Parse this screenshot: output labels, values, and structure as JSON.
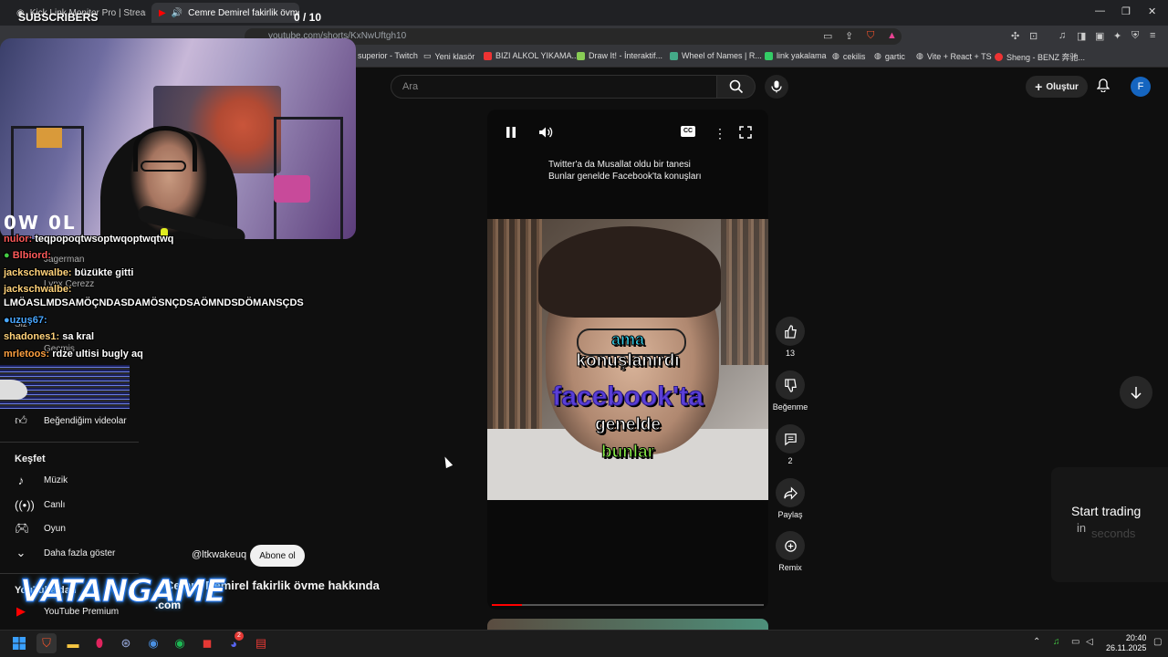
{
  "browser": {
    "tabs": [
      {
        "label": "Kick Link Monitor Pro | Stream Deck",
        "active": false
      },
      {
        "label": "Cemre Demirel fakirlik övme",
        "active": true
      }
    ],
    "new_tab": "+",
    "address": "youtube.com/shorts/KxNwUftgh10",
    "window_controls": {
      "minimize": "—",
      "restore": "❐",
      "close": "✕"
    },
    "bookmarks": [
      "superior - Twitch",
      "Yeni klasör",
      "BIZI ALKOL YIKAMA...",
      "Draw It! - İnteraktif...",
      "Wheel of Names | R...",
      "link yakalama",
      "cekilis",
      "gartic",
      "Vite + React + TS",
      "Sheng - BENZ 奔驰..."
    ]
  },
  "youtube": {
    "search_placeholder": "Ara",
    "create_label": "Oluştur",
    "avatar_letter": "F",
    "sidebar": {
      "hidden_items": [
        "Jagerman",
        "Lynx Cerezz",
        "Siz",
        "Geçmiş"
      ],
      "liked_videos": "Beğendiğim videolar",
      "explore_heading": "Keşfet",
      "explore_items": [
        "Müzik",
        "Canlı",
        "Oyun"
      ],
      "show_more": "Daha fazla göster",
      "more_heading": "YouTube'dan",
      "premium": "YouTube Premium"
    },
    "short": {
      "top_caption_line1": "Twitter'a da Musallat oldu bir tanesi",
      "top_caption_line2": "Bunlar genelde Facebook'ta konuşları",
      "subtitles": [
        "ama",
        "konuşlanırdı",
        "facebook'ta",
        "genelde",
        "bunlar"
      ],
      "progress": 0.11,
      "channel": "@ltkwakeuq",
      "subscribe": "Abone ol",
      "title": "Cemre Demirel fakirlik övme hakkında"
    },
    "actions": {
      "like_count": "13",
      "dislike_label": "Beğenme",
      "comment_count": "2",
      "share_label": "Paylaş",
      "remix_label": "Remix"
    },
    "ad": {
      "line1": "Start trading",
      "line2a": "in",
      "line2b": "seconds"
    }
  },
  "overlay": {
    "subscribers_label": "SUBSCRIBERS",
    "subscribers_count": "0 / 10",
    "streamer_tag": "0W 0L",
    "chat": [
      {
        "user": "nulor:",
        "msg": "teqpopoqtwsoptwqoptwqtwq"
      },
      {
        "user": "Blbiord:",
        "msg": ""
      },
      {
        "user": "jackschwalbe:",
        "msg": "büzükte gitti"
      },
      {
        "user": "jackschwalbe:",
        "msg": ""
      },
      {
        "user": "",
        "msg": "LMÖASLMDSAMÖÇNDASDAMÖSNÇDSAÖMNDSDÖMANSÇDS"
      },
      {
        "user": "uzuş67:",
        "msg": ""
      },
      {
        "user": "shadones1:",
        "msg": "sa kral"
      },
      {
        "user": "mrletoos:",
        "msg": "rdze ultisi bugly aq"
      }
    ],
    "logo_main": "VATANGAME",
    "logo_sub": ".com"
  },
  "taskbar": {
    "time": "20:40",
    "date": "26.11.2025",
    "discord_badge": "2"
  }
}
